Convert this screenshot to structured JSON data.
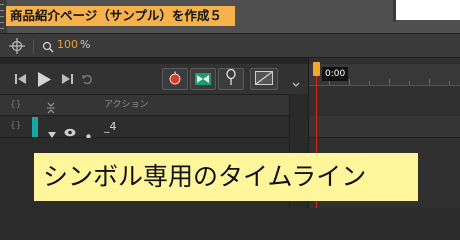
{
  "document": {
    "title_banner": "商品紹介ページ（サンプル）を作成５"
  },
  "edit_bar": {
    "zoom_value": "100",
    "zoom_unit": "%"
  },
  "timeline": {
    "current_time": "0:00",
    "layer_header": {
      "action_label": "アクション"
    },
    "layers": [
      {
        "name": "_4"
      }
    ]
  },
  "caption": {
    "text": "シンボル専用のタイムライン"
  },
  "colors": {
    "banner": "#f5b24a",
    "caption": "#fff59a",
    "playhead": "#d8261e",
    "layer_accent": "#19a6a0",
    "zoom_value": "#f0a030"
  },
  "icons": {
    "transport": [
      "skip-to-start-icon",
      "play-icon",
      "skip-to-end-icon",
      "loop-icon"
    ],
    "tools": [
      "onion-skin-apple-icon",
      "center-frame-icon",
      "pin-icon",
      "edit-multiple-frames-icon"
    ]
  }
}
